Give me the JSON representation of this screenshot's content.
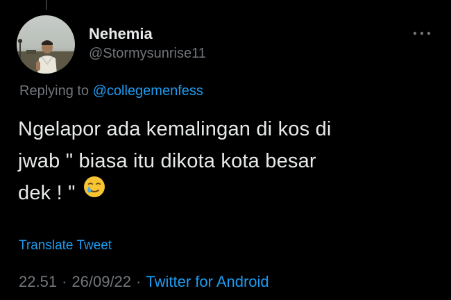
{
  "tweet": {
    "author": {
      "name": "Nehemia",
      "handle": "@Stormysunrise11"
    },
    "replying_prefix": "Replying to ",
    "replying_to": "@collegemenfess",
    "text_lines": [
      "Ngelapor ada kemalingan di kos di",
      "jwab \" biasa itu dikota kota besar",
      "dek ! \""
    ],
    "emoji": "crying-smile-emoji",
    "translate_label": "Translate Tweet",
    "time": "22.51",
    "date": "26/09/22",
    "separator": "·",
    "source": "Twitter for Android"
  },
  "icons": {
    "more": "more-horizontal-icon"
  },
  "colors": {
    "background": "#000000",
    "text": "#e7e9ea",
    "muted": "#71767b",
    "accent": "#1d9bf0"
  }
}
